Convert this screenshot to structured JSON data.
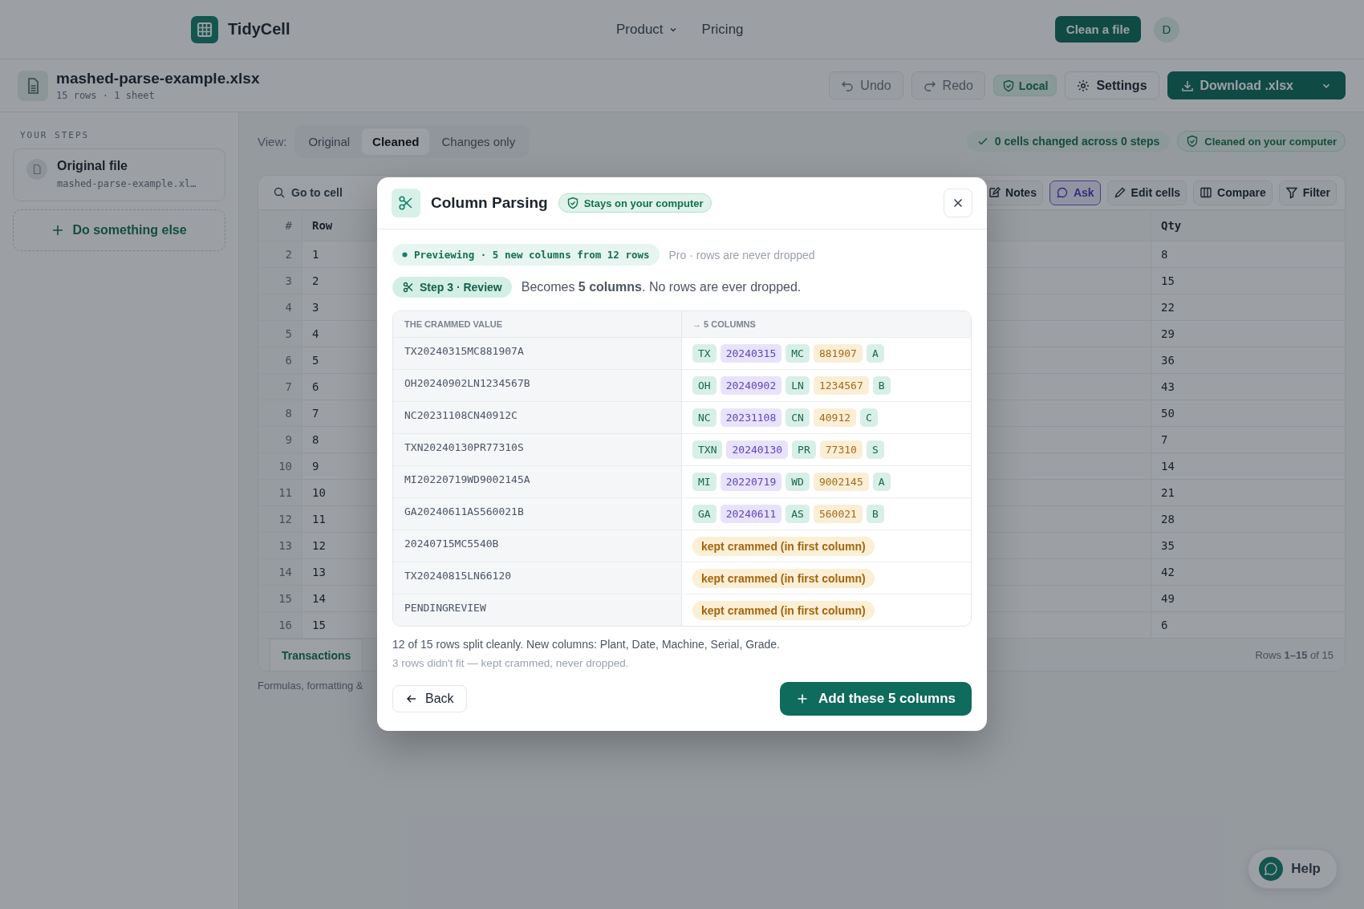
{
  "nav": {
    "brand": "TidyCell",
    "links": [
      {
        "label": "Product",
        "dropdown": true
      },
      {
        "label": "Pricing",
        "dropdown": false
      }
    ],
    "cta": "Clean a file",
    "avatar": "D"
  },
  "file_bar": {
    "filename": "mashed-parse-example.xlsx",
    "meta": "15 rows · 1 sheet",
    "actions": [
      {
        "kind": "undo",
        "label": "Undo",
        "disabled": true
      },
      {
        "kind": "redo",
        "label": "Redo",
        "disabled": true
      },
      {
        "kind": "local",
        "label": "Local",
        "disabled": false
      },
      {
        "kind": "settings",
        "label": "Settings",
        "disabled": false
      },
      {
        "kind": "download",
        "label": "Download .xlsx",
        "disabled": false
      }
    ]
  },
  "sidebar": {
    "heading": "YOUR STEPS",
    "steps": [
      {
        "title": "Original file",
        "subtitle": "mashed-parse-example.xl…"
      }
    ],
    "add_button": "Do something else"
  },
  "view": {
    "label": "View:",
    "options": [
      {
        "label": "Original",
        "selected": false
      },
      {
        "label": "Cleaned",
        "selected": true
      },
      {
        "label": "Changes only",
        "selected": false
      }
    ]
  },
  "status": {
    "changes": "0 cells changed across 0 steps",
    "privacy": "Cleaned on your computer"
  },
  "grid": {
    "search": "Go to cell",
    "tools": [
      {
        "kind": "notes",
        "label": "Notes",
        "selected": false
      },
      {
        "kind": "ask",
        "label": "Ask",
        "selected": true
      },
      {
        "kind": "edit",
        "label": "Edit cells",
        "selected": false
      },
      {
        "kind": "compare",
        "label": "Compare",
        "selected": false
      },
      {
        "kind": "filter",
        "label": "Filter",
        "selected": false
      }
    ],
    "columns": [
      "#",
      "Row",
      "Qty"
    ],
    "rows": [
      {
        "n": "2",
        "row": "1",
        "qty": "8"
      },
      {
        "n": "3",
        "row": "2",
        "qty": "15"
      },
      {
        "n": "4",
        "row": "3",
        "qty": "22"
      },
      {
        "n": "5",
        "row": "4",
        "qty": "29"
      },
      {
        "n": "6",
        "row": "5",
        "qty": "36"
      },
      {
        "n": "7",
        "row": "6",
        "qty": "43"
      },
      {
        "n": "8",
        "row": "7",
        "qty": "50"
      },
      {
        "n": "9",
        "row": "8",
        "qty": "7"
      },
      {
        "n": "10",
        "row": "9",
        "qty": "14"
      },
      {
        "n": "11",
        "row": "10",
        "qty": "21"
      },
      {
        "n": "12",
        "row": "11",
        "qty": "28"
      },
      {
        "n": "13",
        "row": "12",
        "qty": "35"
      },
      {
        "n": "14",
        "row": "13",
        "qty": "42"
      },
      {
        "n": "15",
        "row": "14",
        "qty": "49"
      },
      {
        "n": "16",
        "row": "15",
        "qty": "6"
      }
    ],
    "sheet_tabs": [
      {
        "label": "Transactions",
        "selected": true
      }
    ],
    "rows_info": "Rows **1–15** of 15"
  },
  "footnote": "Formulas, formatting &",
  "help": "Help",
  "dialog": {
    "title": "Column Parsing",
    "badge": "Stays on your computer",
    "preview": "Previewing · 5 new columns from 12 rows",
    "preview_note": "Pro · rows are never dropped",
    "step": "Step 3 · Review",
    "step_text": "Becomes **5 columns**. No rows are ever dropped.",
    "columns": [
      "THE CRAMMED VALUE",
      "→ 5 COLUMNS"
    ],
    "rows": [
      {
        "value": "TX20240315MC881907A",
        "parts": [
          {
            "text": "TX",
            "kind": "code"
          },
          {
            "text": "20240315",
            "kind": "date"
          },
          {
            "text": "MC",
            "kind": "code"
          },
          {
            "text": "881907",
            "kind": "serial"
          },
          {
            "text": "A",
            "kind": "code"
          }
        ]
      },
      {
        "value": "OH20240902LN1234567B",
        "parts": [
          {
            "text": "OH",
            "kind": "code"
          },
          {
            "text": "20240902",
            "kind": "date"
          },
          {
            "text": "LN",
            "kind": "code"
          },
          {
            "text": "1234567",
            "kind": "serial"
          },
          {
            "text": "B",
            "kind": "code"
          }
        ]
      },
      {
        "value": "NC20231108CN40912C",
        "parts": [
          {
            "text": "NC",
            "kind": "code"
          },
          {
            "text": "20231108",
            "kind": "date"
          },
          {
            "text": "CN",
            "kind": "code"
          },
          {
            "text": "40912",
            "kind": "serial"
          },
          {
            "text": "C",
            "kind": "code"
          }
        ]
      },
      {
        "value": "TXN20240130PR77310S",
        "parts": [
          {
            "text": "TXN",
            "kind": "code"
          },
          {
            "text": "20240130",
            "kind": "date"
          },
          {
            "text": "PR",
            "kind": "code"
          },
          {
            "text": "77310",
            "kind": "serial"
          },
          {
            "text": "S",
            "kind": "code"
          }
        ]
      },
      {
        "value": "MI20220719WD9002145A",
        "parts": [
          {
            "text": "MI",
            "kind": "code"
          },
          {
            "text": "20220719",
            "kind": "date"
          },
          {
            "text": "WD",
            "kind": "code"
          },
          {
            "text": "9002145",
            "kind": "serial"
          },
          {
            "text": "A",
            "kind": "code"
          }
        ]
      },
      {
        "value": "GA20240611AS560021B",
        "parts": [
          {
            "text": "GA",
            "kind": "code"
          },
          {
            "text": "20240611",
            "kind": "date"
          },
          {
            "text": "AS",
            "kind": "code"
          },
          {
            "text": "560021",
            "kind": "serial"
          },
          {
            "text": "B",
            "kind": "code"
          }
        ]
      },
      {
        "value": "20240715MC5540B",
        "fallback": "kept crammed (in first column)"
      },
      {
        "value": "TX20240815LN66120",
        "fallback": "kept crammed (in first column)"
      },
      {
        "value": "PENDINGREVIEW",
        "fallback": "kept crammed (in first column)"
      }
    ],
    "summary": "12 of 15 rows split cleanly. New columns: Plant, Date, Machine, Serial, Grade.",
    "note": "3 rows didn't fit — kept crammed, never dropped.",
    "back": "Back",
    "confirm": "Add these 5 columns"
  }
}
